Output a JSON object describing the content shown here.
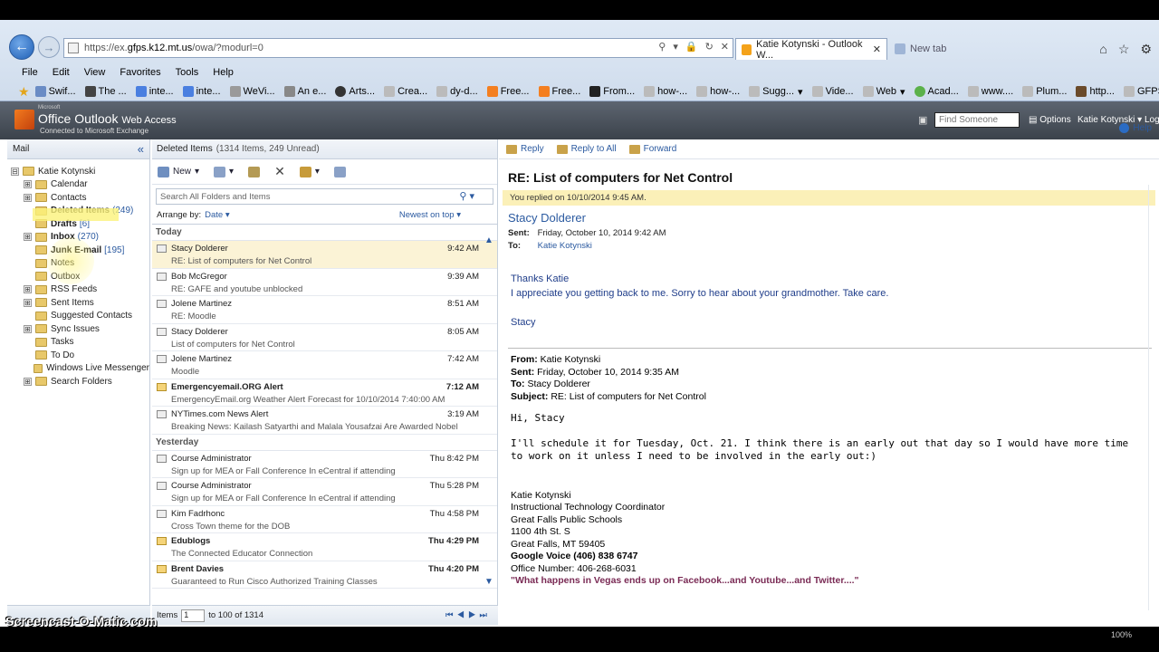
{
  "browser": {
    "url_prefix": "https://ex.",
    "url_domain": "gfps.k12.mt.us",
    "url_path": "/owa/?modurl=0",
    "address_icons": [
      "⚲",
      "▾",
      "🔒",
      "↻",
      "✕"
    ],
    "tabs": [
      {
        "label": "Katie Kotynski - Outlook W..."
      },
      {
        "label": "New tab"
      }
    ],
    "menu": [
      "File",
      "Edit",
      "View",
      "Favorites",
      "Tools",
      "Help"
    ],
    "favorites": [
      "Swif...",
      "The ...",
      "inte...",
      "inte...",
      "WeVi...",
      "An e...",
      "Arts...",
      "Crea...",
      "dy-d...",
      "Free...",
      "Free...",
      "From...",
      "how-...",
      "how-...",
      "Sugg...",
      "Vide...",
      "Web",
      "Acad...",
      "www....",
      "Plum...",
      "http...",
      "GFPS..."
    ]
  },
  "owa": {
    "brand_small": "Microsoft",
    "brand": "Office Outlook",
    "brand_suffix": "Web Access",
    "connected": "Connected to Microsoft Exchange",
    "find_placeholder": "Find Someone",
    "options": "Options",
    "user": "Katie Kotynski ▾",
    "logoff": "Log"
  },
  "sidebar": {
    "title": "Mail",
    "collapse": "«",
    "items": [
      {
        "label": "Katie Kotynski",
        "count": "",
        "bold": false,
        "exp": "⊟",
        "indent": 0
      },
      {
        "label": "Calendar",
        "count": "",
        "bold": false,
        "exp": "⊞",
        "indent": 1
      },
      {
        "label": "Contacts",
        "count": "",
        "bold": false,
        "exp": "⊞",
        "indent": 1
      },
      {
        "label": "Deleted Items",
        "count": "(249)",
        "bold": true,
        "exp": "",
        "indent": 1
      },
      {
        "label": "Drafts",
        "count": "[6]",
        "bold": true,
        "exp": "",
        "indent": 1
      },
      {
        "label": "Inbox",
        "count": "(270)",
        "bold": true,
        "exp": "⊞",
        "indent": 1
      },
      {
        "label": "Junk E-mail",
        "count": "[195]",
        "bold": true,
        "exp": "",
        "indent": 1
      },
      {
        "label": "Notes",
        "count": "",
        "bold": false,
        "exp": "",
        "indent": 1
      },
      {
        "label": "Outbox",
        "count": "",
        "bold": false,
        "exp": "",
        "indent": 1
      },
      {
        "label": "RSS Feeds",
        "count": "",
        "bold": false,
        "exp": "⊞",
        "indent": 1
      },
      {
        "label": "Sent Items",
        "count": "",
        "bold": false,
        "exp": "⊞",
        "indent": 1
      },
      {
        "label": "Suggested Contacts",
        "count": "",
        "bold": false,
        "exp": "",
        "indent": 1
      },
      {
        "label": "Sync Issues",
        "count": "",
        "bold": false,
        "exp": "⊞",
        "indent": 1
      },
      {
        "label": "Tasks",
        "count": "",
        "bold": false,
        "exp": "",
        "indent": 1
      },
      {
        "label": "To Do",
        "count": "",
        "bold": false,
        "exp": "",
        "indent": 1
      },
      {
        "label": "Windows Live Messenger",
        "count": "",
        "bold": false,
        "exp": "",
        "indent": 1
      },
      {
        "label": "Search Folders",
        "count": "",
        "bold": false,
        "exp": "⊞",
        "indent": 1
      }
    ]
  },
  "list": {
    "folder": "Deleted Items",
    "summary": "(1314 Items, 249 Unread)",
    "toolbar_new": "New",
    "search_placeholder": "Search All Folders and Items",
    "arrange_label": "Arrange by:",
    "arrange_value": "Date ▾",
    "order": "Newest on top ▾",
    "groups": [
      {
        "label": "Today",
        "messages": [
          {
            "from": "Stacy Dolderer",
            "subject": "RE: List of computers for Net Control",
            "time": "9:42 AM",
            "unread": false,
            "selected": true
          },
          {
            "from": "Bob McGregor",
            "subject": "RE: GAFE and youtube unblocked",
            "time": "9:39 AM",
            "unread": false,
            "selected": false
          },
          {
            "from": "Jolene Martinez",
            "subject": "RE: Moodle",
            "time": "8:51 AM",
            "unread": false,
            "selected": false
          },
          {
            "from": "Stacy Dolderer",
            "subject": "List of computers for Net Control",
            "time": "8:05 AM",
            "unread": false,
            "selected": false
          },
          {
            "from": "Jolene Martinez",
            "subject": "Moodle",
            "time": "7:42 AM",
            "unread": false,
            "selected": false
          },
          {
            "from": "Emergencyemail.ORG Alert",
            "subject": "EmergencyEmail.org Weather Alert Forecast for 10/10/2014 7:40:00 AM",
            "time": "7:12 AM",
            "unread": true,
            "selected": false
          },
          {
            "from": "NYTimes.com News Alert",
            "subject": "Breaking News: Kailash Satyarthi and Malala Yousafzai Are Awarded Nobel P...",
            "time": "3:19 AM",
            "unread": false,
            "selected": false
          }
        ]
      },
      {
        "label": "Yesterday",
        "messages": [
          {
            "from": "Course Administrator",
            "subject": "Sign up for MEA or Fall Conference In eCentral if attending",
            "time": "Thu 8:42 PM",
            "unread": false,
            "selected": false
          },
          {
            "from": "Course Administrator",
            "subject": "Sign up for MEA or Fall Conference In eCentral if attending",
            "time": "Thu 5:28 PM",
            "unread": false,
            "selected": false
          },
          {
            "from": "Kim Fadrhonc",
            "subject": "Cross Town theme for the DOB",
            "time": "Thu 4:58 PM",
            "unread": false,
            "selected": false
          },
          {
            "from": "Edublogs",
            "subject": "The Connected Educator Connection",
            "time": "Thu 4:29 PM",
            "unread": true,
            "selected": false
          },
          {
            "from": "Brent Davies",
            "subject": "Guaranteed to Run Cisco Authorized Training Classes",
            "time": "Thu 4:20 PM",
            "unread": true,
            "selected": false
          }
        ]
      }
    ],
    "footer_items": "Items",
    "footer_page": "1",
    "footer_range": "to 100 of 1314",
    "footer_nav": "⏮◀▶⏭"
  },
  "reading": {
    "reply": "Reply",
    "reply_all": "Reply to All",
    "forward": "Forward",
    "help": "Help",
    "subject": "RE: List of computers for Net Control",
    "replied_note": "You replied on 10/10/2014 9:45 AM.",
    "from_name": "Stacy Dolderer",
    "sent_label": "Sent:",
    "sent_value": "Friday, October 10, 2014 9:42 AM",
    "to_label": "To:",
    "to_value": "Katie Kotynski",
    "body": [
      "Thanks Katie",
      "I appreciate you getting back to me.  Sorry to hear about your grandmother.  Take care.",
      "",
      "Stacy"
    ],
    "q_from": "From: Katie Kotynski",
    "q_sent": "Sent: Friday, October 10, 2014 9:35 AM",
    "q_to": "To: Stacy Dolderer",
    "q_subject": "Subject: RE: List of computers for Net Control",
    "q_greeting": "Hi, Stacy",
    "q_text": "I'll schedule it for Tuesday, Oct. 21.  I think there is an early out that day so I would have more time to work on it unless I need to be involved in the early out:)",
    "sig": [
      "Katie Kotynski",
      "Instructional Technology Coordinator",
      "Great Falls Public Schools",
      "1100 4th St. S",
      "Great Falls, MT 59405"
    ],
    "sig_voice": "Google Voice (406) 838 6747",
    "sig_office": "Office Number: 406-268-6031",
    "sig_quote": "\"What happens in Vegas ends up on Facebook...and Youtube...and Twitter....\""
  },
  "watermark": "Screencast-O-Matic.com",
  "zoom": "100%"
}
